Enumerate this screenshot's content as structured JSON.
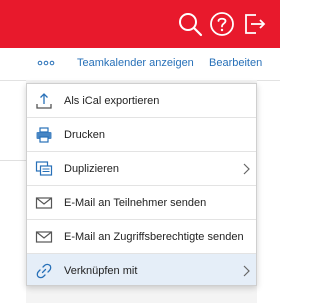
{
  "header": {
    "accent_color": "#e8192c",
    "icons": [
      "search-icon",
      "help-icon",
      "logout-icon"
    ]
  },
  "toolbar": {
    "more_icon": "more-horizontal-icon",
    "teamkalender_label": "Teamkalender anzeigen",
    "bearbeiten_label": "Bearbeiten",
    "link_color": "#2770b8"
  },
  "menu": {
    "items": [
      {
        "label": "Als iCal exportieren",
        "icon": "export-upload-icon",
        "submenu": false
      },
      {
        "label": "Drucken",
        "icon": "printer-icon",
        "submenu": false
      },
      {
        "label": "Duplizieren",
        "icon": "duplicate-icon",
        "submenu": true
      },
      {
        "label": "E-Mail an Teilnehmer senden",
        "icon": "mail-icon",
        "submenu": false
      },
      {
        "label": "E-Mail an Zugriffsberechtigte senden",
        "icon": "mail-icon",
        "submenu": false
      },
      {
        "label": "Verknüpfen mit",
        "icon": "link-icon",
        "submenu": true,
        "highlighted": true
      }
    ]
  }
}
